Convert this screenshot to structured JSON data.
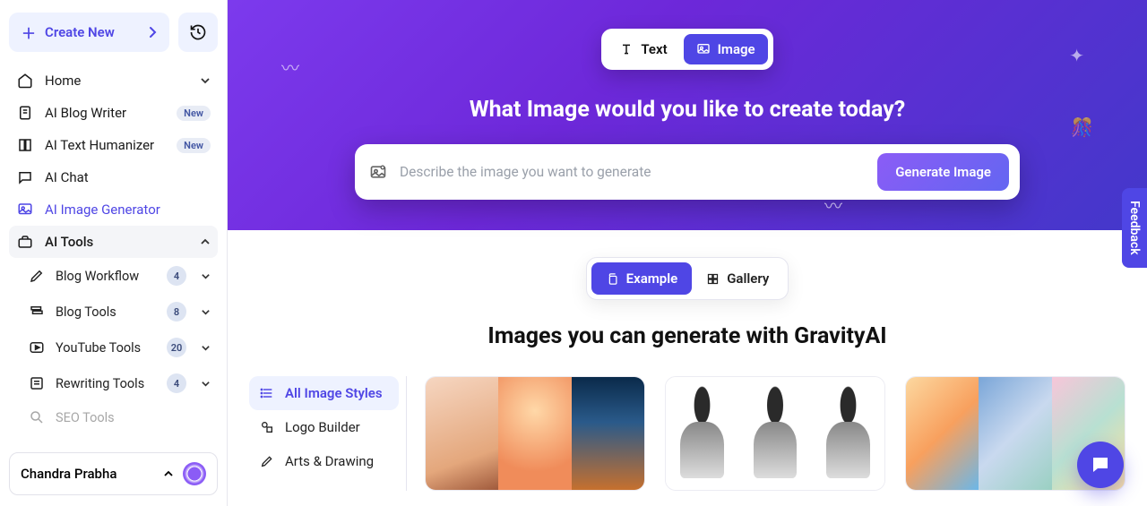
{
  "sidebar": {
    "create_label": "Create New",
    "nav": [
      {
        "label": "Home"
      },
      {
        "label": "AI Blog Writer",
        "badge": "New"
      },
      {
        "label": "AI Text Humanizer",
        "badge": "New"
      },
      {
        "label": "AI Chat"
      },
      {
        "label": "AI Image Generator"
      },
      {
        "label": "AI Tools"
      }
    ],
    "sub": [
      {
        "label": "Blog Workflow",
        "count": "4"
      },
      {
        "label": "Blog Tools",
        "count": "8"
      },
      {
        "label": "YouTube Tools",
        "count": "20"
      },
      {
        "label": "Rewriting Tools",
        "count": "4"
      },
      {
        "label": "SEO Tools",
        "count": ""
      }
    ],
    "user_name": "Chandra Prabha"
  },
  "hero": {
    "mode_text": "Text",
    "mode_image": "Image",
    "headline": "What Image would you like to create today?",
    "placeholder": "Describe the image you want to generate",
    "generate_label": "Generate Image"
  },
  "view": {
    "example": "Example",
    "gallery": "Gallery"
  },
  "subheadline": "Images you can generate with GravityAI",
  "styles": [
    "All Image Styles",
    "Logo Builder",
    "Arts & Drawing"
  ],
  "feedback_label": "Feedback"
}
